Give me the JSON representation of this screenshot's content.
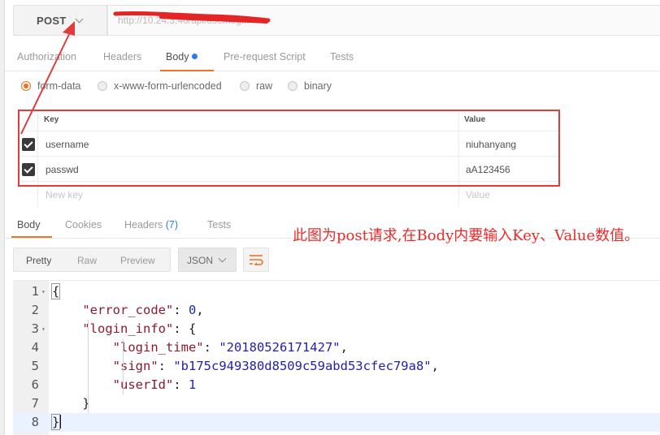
{
  "request": {
    "method": "POST",
    "url": "http://10.24.3.40/api/user/login"
  },
  "request_tabs": [
    {
      "label": "Authorization",
      "active": false
    },
    {
      "label": "Headers",
      "active": false
    },
    {
      "label": "Body",
      "active": true,
      "modified": true
    },
    {
      "label": "Pre-request Script",
      "active": false
    },
    {
      "label": "Tests",
      "active": false
    }
  ],
  "body_types": [
    {
      "label": "form-data",
      "selected": true
    },
    {
      "label": "x-www-form-urlencoded",
      "selected": false
    },
    {
      "label": "raw",
      "selected": false
    },
    {
      "label": "binary",
      "selected": false
    }
  ],
  "params": {
    "key_header": "Key",
    "value_header": "Value",
    "rows": [
      {
        "checked": true,
        "key": "username",
        "value": "niuhanyang"
      },
      {
        "checked": true,
        "key": "passwd",
        "value": "aA123456"
      }
    ],
    "new_key_placeholder": "New key",
    "new_value_placeholder": "Value"
  },
  "response_tabs": [
    {
      "label": "Body",
      "active": true
    },
    {
      "label": "Cookies",
      "active": false
    },
    {
      "label": "Headers",
      "count": "(7)",
      "active": false
    },
    {
      "label": "Tests",
      "active": false
    }
  ],
  "view_modes": [
    {
      "label": "Pretty",
      "active": true
    },
    {
      "label": "Raw",
      "active": false
    },
    {
      "label": "Preview",
      "active": false
    }
  ],
  "format": "JSON",
  "annotation": "此图为post请求,在Body内要输入Key、Value数值。",
  "response_lines": [
    {
      "n": "1",
      "fold": true,
      "text": "{"
    },
    {
      "n": "2",
      "fold": false,
      "key": "\"error_code\"",
      "num": "0",
      "tail": ","
    },
    {
      "n": "3",
      "fold": true,
      "key": "\"login_info\"",
      "tail": " {"
    },
    {
      "n": "4",
      "fold": false,
      "key": "\"login_time\"",
      "str": "\"20180526171427\"",
      "tail": ","
    },
    {
      "n": "5",
      "fold": false,
      "key": "\"sign\"",
      "str": "\"b175c949380d8509c59abd53cfec79a8\"",
      "tail": ","
    },
    {
      "n": "6",
      "fold": false,
      "key": "\"userId\"",
      "num": "1",
      "tail": ""
    },
    {
      "n": "7",
      "fold": false,
      "text": "}"
    },
    {
      "n": "8",
      "fold": false,
      "text": "}",
      "current": true
    }
  ],
  "colors": {
    "accent": "#f47023",
    "annotation": "#ee2a2a",
    "link": "#2a7ce8"
  }
}
